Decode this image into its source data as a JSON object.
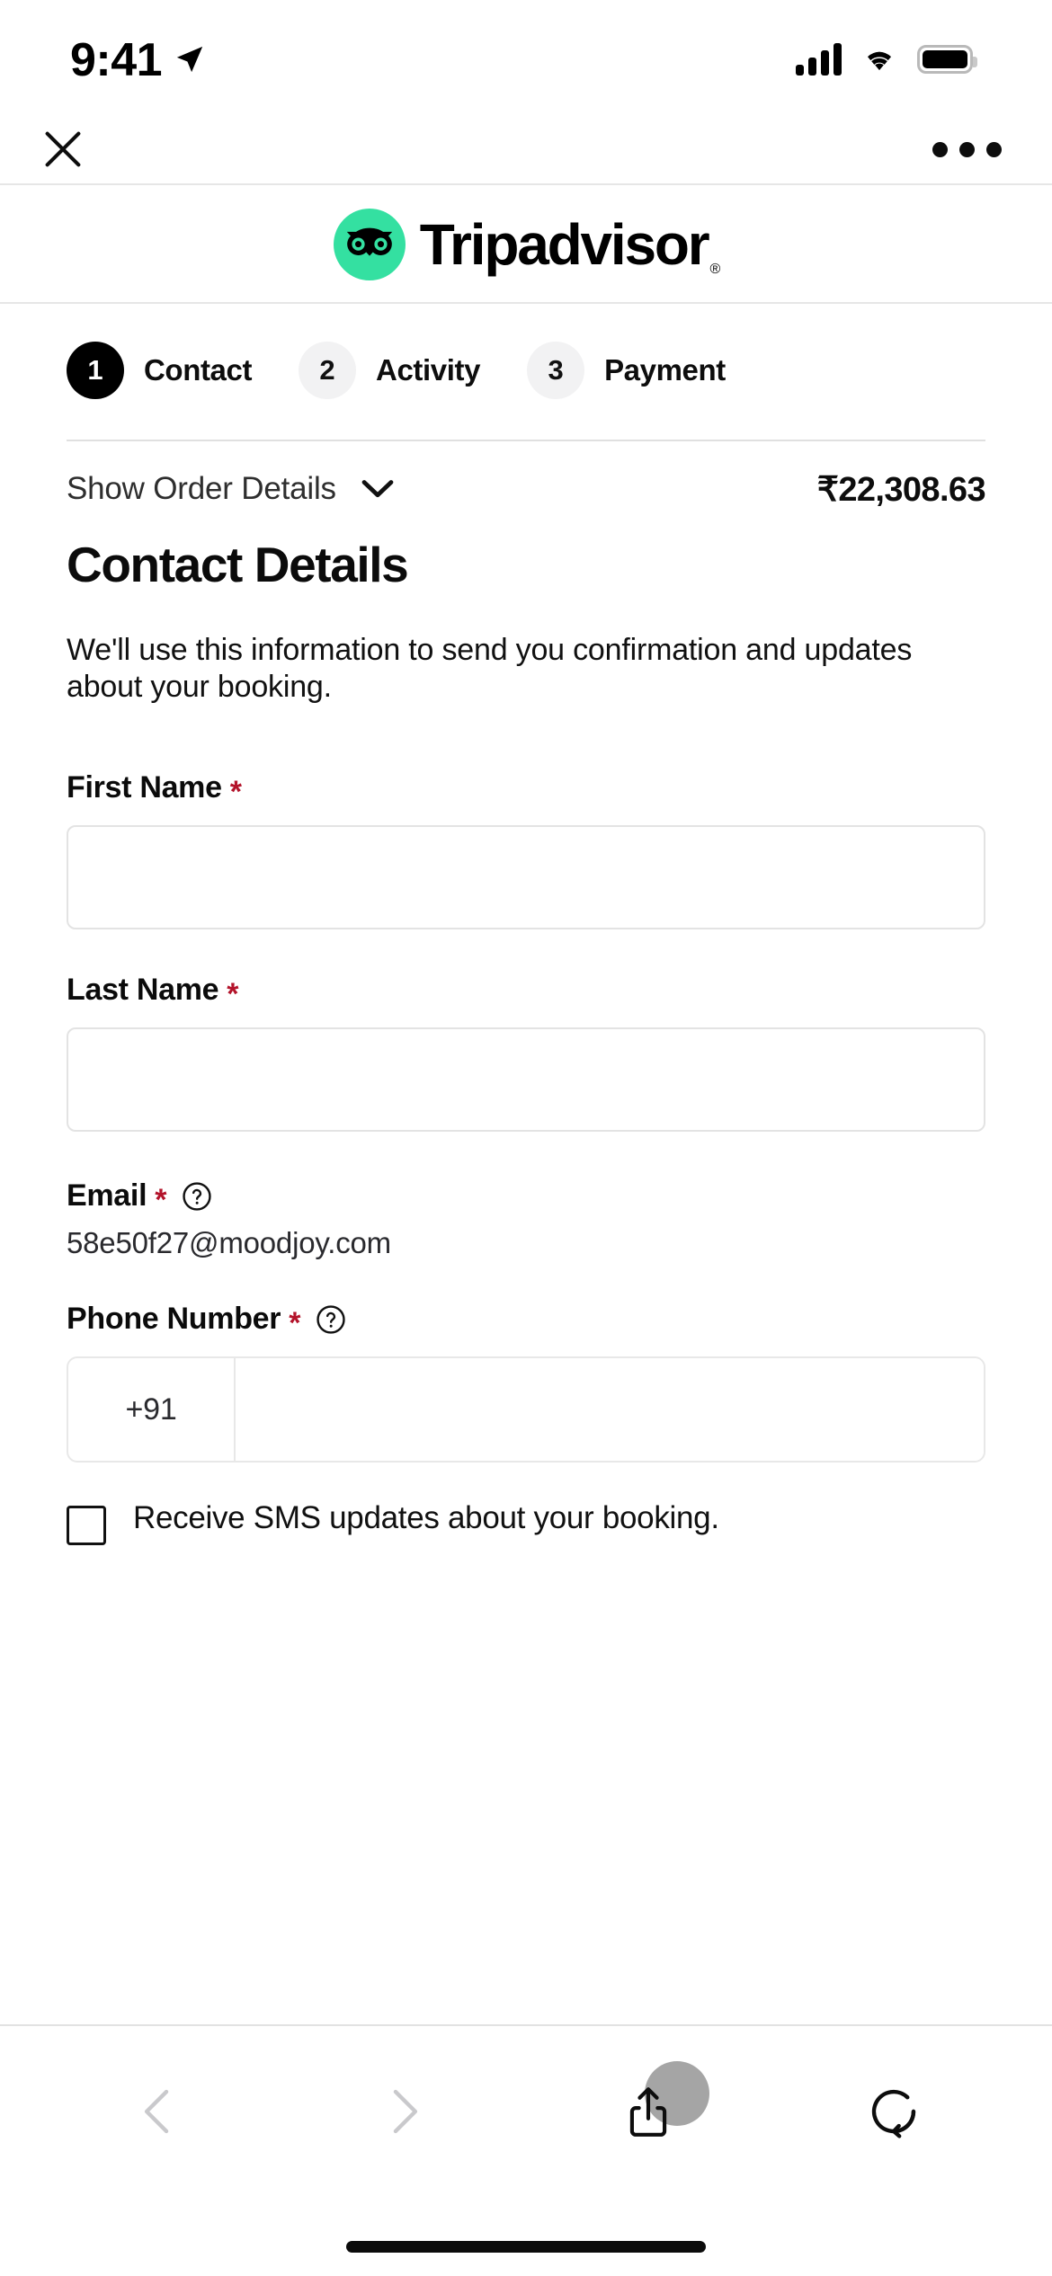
{
  "status_bar": {
    "time": "9:41",
    "location_icon": "location-arrow-icon",
    "signal_icon": "cellular-signal-icon",
    "wifi_icon": "wifi-icon",
    "battery_icon": "battery-full-icon"
  },
  "browser_top": {
    "close_label": "close-icon",
    "menu_label": "more-options-icon"
  },
  "brand": {
    "name": "Tripadvisor",
    "registered_mark": "®",
    "logo_icon": "tripadvisor-owl-icon",
    "logo_color": "#34E0A1"
  },
  "steps": [
    {
      "number": "1",
      "label": "Contact",
      "state": "active"
    },
    {
      "number": "2",
      "label": "Activity",
      "state": "inactive"
    },
    {
      "number": "3",
      "label": "Payment",
      "state": "inactive"
    }
  ],
  "order_summary": {
    "toggle_label": "Show Order Details",
    "toggle_icon": "chevron-down-icon",
    "total_price": "₹22,308.63"
  },
  "main": {
    "title": "Contact Details",
    "description": "We'll use this information to send you confirmation and updates about your booking.",
    "fields": {
      "first_name": {
        "label": "First Name",
        "required_mark": "*",
        "value": "",
        "placeholder": ""
      },
      "last_name": {
        "label": "Last Name",
        "required_mark": "*",
        "value": "",
        "placeholder": ""
      },
      "email": {
        "label": "Email",
        "required_mark": "*",
        "help_icon": "question-circle-icon",
        "value": "58e50f27@moodjoy.com"
      },
      "phone": {
        "label": "Phone Number",
        "required_mark": "*",
        "help_icon": "question-circle-icon",
        "country_code": "+91",
        "value": "",
        "placeholder": ""
      }
    },
    "sms_consent": {
      "label": "Receive SMS updates about your booking.",
      "checked": false
    }
  },
  "bottom_bar": {
    "back_icon": "chevron-left-icon",
    "forward_icon": "chevron-right-icon",
    "share_icon": "share-up-icon",
    "reload_icon": "reload-icon"
  },
  "colors": {
    "brand_green": "#34E0A1",
    "required_red": "#B3132A",
    "active_step": "#000000",
    "inactive_step_bg": "#F2F2F3"
  }
}
